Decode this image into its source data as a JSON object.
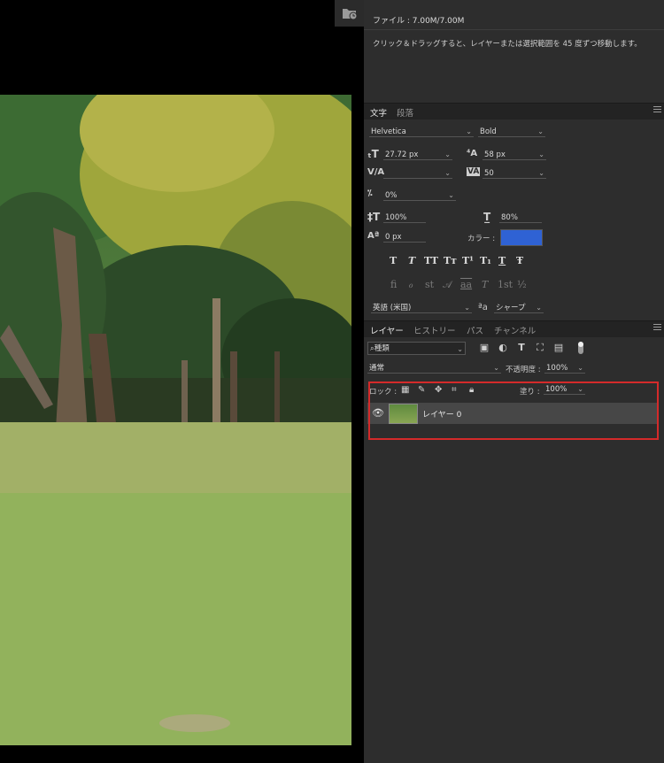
{
  "info": {
    "file_size": "ファイル : 7.00M/7.00M",
    "hint": "クリック＆ドラッグすると、レイヤーまたは選択範囲を 45 度ずつ移動します。"
  },
  "character_panel": {
    "tabs": [
      "文字",
      "段落"
    ],
    "font_family": "Helvetica",
    "font_style": "Bold",
    "font_size": "27.72 px",
    "leading": "58 px",
    "kerning": "",
    "tracking": "50",
    "tsume": "0%",
    "vertical_scale": "100%",
    "horizontal_scale": "80%",
    "baseline_shift": "0 px",
    "color_label": "カラー :",
    "color_value": "#2f62d4",
    "styles": [
      "T",
      "T",
      "TT",
      "Tт",
      "T¹",
      "T₁",
      "T",
      "Ŧ"
    ],
    "opentype": [
      "ﬁ",
      "ℴ",
      "st",
      "𝒜",
      "aa",
      "T",
      "1st",
      "½"
    ],
    "language": "英語 (米国)",
    "aa_label": "ªa",
    "antialias": "シャープ"
  },
  "layers_panel": {
    "tabs": [
      "レイヤー",
      "ヒストリー",
      "パス",
      "チャンネル"
    ],
    "filter_kind": "種類",
    "blend_mode": "通常",
    "opacity_label": "不透明度 :",
    "opacity_value": "100%",
    "lock_label": "ロック :",
    "fill_label": "塗り :",
    "fill_value": "100%",
    "layers": [
      {
        "name": "レイヤー 0",
        "visible": true
      }
    ]
  }
}
